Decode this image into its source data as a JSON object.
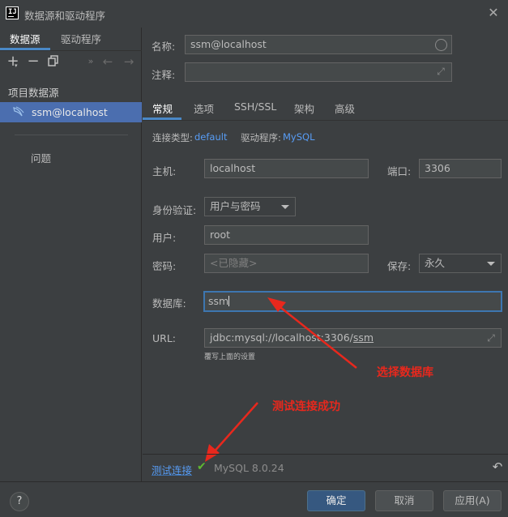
{
  "window": {
    "title": "数据源和驱动程序",
    "app_icon": "IJ"
  },
  "left": {
    "tabs": [
      {
        "label": "数据源"
      },
      {
        "label": "驱动程序"
      }
    ],
    "section_title": "项目数据源",
    "datasource": {
      "label": "ssm@localhost"
    },
    "problems": "问题"
  },
  "form": {
    "name_label": "名称:",
    "name_value": "ssm@localhost",
    "comment_label": "注释:",
    "tabs": [
      {
        "label": "常规"
      },
      {
        "label": "选项"
      },
      {
        "label": "SSH/SSL"
      },
      {
        "label": "架构"
      },
      {
        "label": "高级"
      }
    ],
    "conn_type_label": "连接类型:",
    "conn_type_value": "default",
    "driver_label": "驱动程序:",
    "driver_value": "MySQL",
    "host_label": "主机:",
    "host_value": "localhost",
    "port_label": "端口:",
    "port_value": "3306",
    "auth_label": "身份验证:",
    "auth_value": "用户与密码",
    "user_label": "用户:",
    "user_value": "root",
    "password_label": "密码:",
    "password_placeholder": "<已隐藏>",
    "save_label": "保存:",
    "save_value": "永久",
    "database_label": "数据库:",
    "database_value": "ssm",
    "url_label": "URL:",
    "url_prefix": "jdbc:mysql://localhost:3306/",
    "url_db": "ssm",
    "url_hint": "覆写上面的设置"
  },
  "annotations": {
    "select_db": "选择数据库",
    "test_success": "测试连接成功"
  },
  "footer": {
    "test_link": "测试连接",
    "test_result": "MySQL 8.0.24",
    "help": "?",
    "ok": "确定",
    "cancel": "取消",
    "apply": "应用(A)"
  },
  "colors": {
    "accent": "#4a88c7",
    "link": "#589df6",
    "annotation": "#e8281d",
    "success": "#5fb832"
  }
}
